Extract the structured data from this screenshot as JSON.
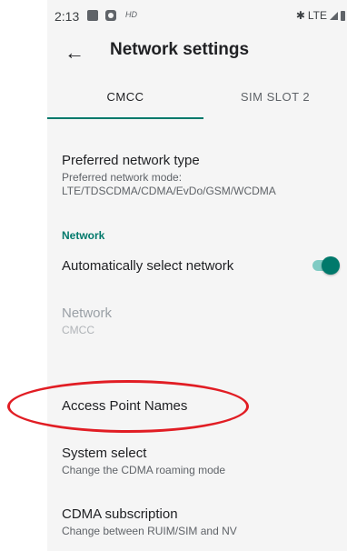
{
  "status_bar": {
    "time": "2:13",
    "hd_label": "HD",
    "network_label": "LTE"
  },
  "toolbar": {
    "back_icon": "arrow-back-icon",
    "title": "Network settings"
  },
  "tabs": [
    {
      "label": "CMCC",
      "selected": true
    },
    {
      "label": "SIM SLOT 2",
      "selected": false
    }
  ],
  "settings": {
    "preferred_network": {
      "title": "Preferred network type",
      "summary": "Preferred network mode: LTE/TDSCDMA/CDMA/EvDo/GSM/WCDMA"
    },
    "network_category": "Network",
    "auto_select": {
      "title": "Automatically select network",
      "enabled": true
    },
    "network": {
      "title": "Network",
      "summary": "CMCC"
    },
    "apn": {
      "title": "Access Point Names"
    },
    "system_select": {
      "title": "System select",
      "summary": "Change the CDMA roaming mode"
    },
    "cdma_subscription": {
      "title": "CDMA subscription",
      "summary": "Change between RUIM/SIM and NV"
    }
  },
  "colors": {
    "accent": "#00796b",
    "annotation": "#e11d24"
  }
}
